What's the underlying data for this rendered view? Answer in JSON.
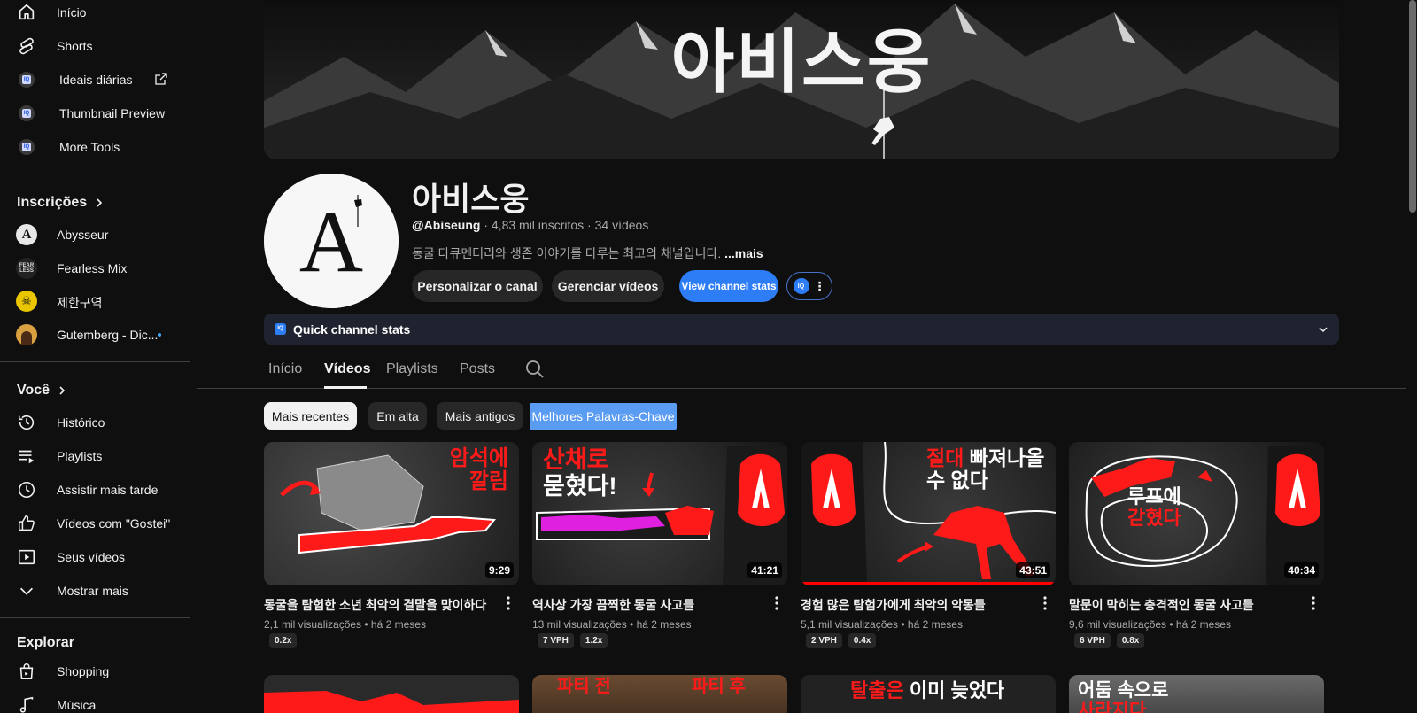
{
  "sidebar": {
    "top_items": [
      {
        "label": "Início",
        "icon": "home-icon"
      },
      {
        "label": "Shorts",
        "icon": "shorts-icon"
      },
      {
        "label": "Ideais diárias",
        "icon": "vidiq-icon"
      },
      {
        "label": "Thumbnail Preview",
        "icon": "vidiq-icon"
      },
      {
        "label": "More Tools",
        "icon": "vidiq-icon"
      }
    ],
    "subscriptions_heading": "Inscrições",
    "subscriptions": [
      {
        "label": "Abysseur"
      },
      {
        "label": "Fearless Mix",
        "avatar_text": "FEAR LESS"
      },
      {
        "label": "제한구역"
      },
      {
        "label": "Gutemberg - Dic..."
      }
    ],
    "you_heading": "Você",
    "you_items": [
      {
        "label": "Histórico",
        "icon": "history-icon"
      },
      {
        "label": "Playlists",
        "icon": "playlists-icon"
      },
      {
        "label": "Assistir mais tarde",
        "icon": "watch-later-icon"
      },
      {
        "label": "Vídeos com \"Gostei\"",
        "icon": "like-icon"
      },
      {
        "label": "Seus vídeos",
        "icon": "your-videos-icon"
      },
      {
        "label": "Mostrar mais",
        "icon": "chevron-down-icon"
      }
    ],
    "explore_heading": "Explorar",
    "explore_items": [
      {
        "label": "Shopping",
        "icon": "shopping-icon"
      },
      {
        "label": "Música",
        "icon": "music-icon"
      }
    ]
  },
  "channel": {
    "banner_title": "아비스웅",
    "name": "아비스웅",
    "handle": "@Abiseung",
    "subscribers": "4,83 mil inscritos",
    "videos_count": "34 vídeos",
    "description": "동굴 다큐멘터리와 생존 이야기를 다루는 최고의 채널입니다.",
    "more_label": "...mais",
    "avatar_letter": "A",
    "buttons": {
      "customize": "Personalizar o canal",
      "manage": "Gerenciar vídeos",
      "stats": "View channel stats"
    },
    "quick_stats": "Quick channel stats"
  },
  "tabs": [
    {
      "label": "Início",
      "active": false
    },
    {
      "label": "Vídeos",
      "active": true
    },
    {
      "label": "Playlists",
      "active": false
    },
    {
      "label": "Posts",
      "active": false
    }
  ],
  "chips": [
    {
      "label": "Mais recentes",
      "active": true
    },
    {
      "label": "Em alta",
      "active": false
    },
    {
      "label": "Mais antigos",
      "active": false
    },
    {
      "label": "Melhores Palavras-Chave",
      "active": false
    }
  ],
  "videos": [
    {
      "title": "동굴을 탐험한 소년 최악의 결말을 맞이하다",
      "views": "2,1 mil visualizações",
      "age": "há 2 meses",
      "duration": "9:29",
      "overlay": [
        "암석에",
        "깔림"
      ],
      "tags": [
        "0.2x"
      ]
    },
    {
      "title": "역사상 가장 끔찍한 동굴 사고들",
      "views": "13 mil visualizações",
      "age": "há 2 meses",
      "duration": "41:21",
      "overlay": [
        "산채로",
        "묻혔다!"
      ],
      "tags": [
        "7 VPH",
        "1.2x"
      ]
    },
    {
      "title": "경험 많은 탐험가에게 최악의 악몽들",
      "views": "5,1 mil visualizações",
      "age": "há 2 meses",
      "duration": "43:51",
      "overlay": [
        "절대",
        "빠져나올",
        "수 없다"
      ],
      "tags": [
        "2 VPH",
        "0.4x"
      ],
      "watched_fraction": 1.0
    },
    {
      "title": "말문이 막히는 충격적인 동굴 사고들",
      "views": "9,6 mil visualizações",
      "age": "há 2 meses",
      "duration": "40:34",
      "overlay": [
        "루프에",
        "갇혔다"
      ],
      "tags": [
        "6 VPH",
        "0.8x"
      ]
    }
  ],
  "next_row_overlays": [
    {
      "texts": []
    },
    {
      "texts": [
        "파티 전",
        "파티 후"
      ]
    },
    {
      "texts": [
        "탈출은",
        "이미 늦었다"
      ]
    },
    {
      "texts": [
        "어둠 속으로",
        "사라지다"
      ]
    }
  ],
  "colors": {
    "background": "#0f0f0f",
    "accent_blue": "#2d7df6",
    "keyword_chip": "#5b9cf3",
    "thumb_red": "#ff1a1a",
    "link_blue": "#3ea6ff"
  }
}
